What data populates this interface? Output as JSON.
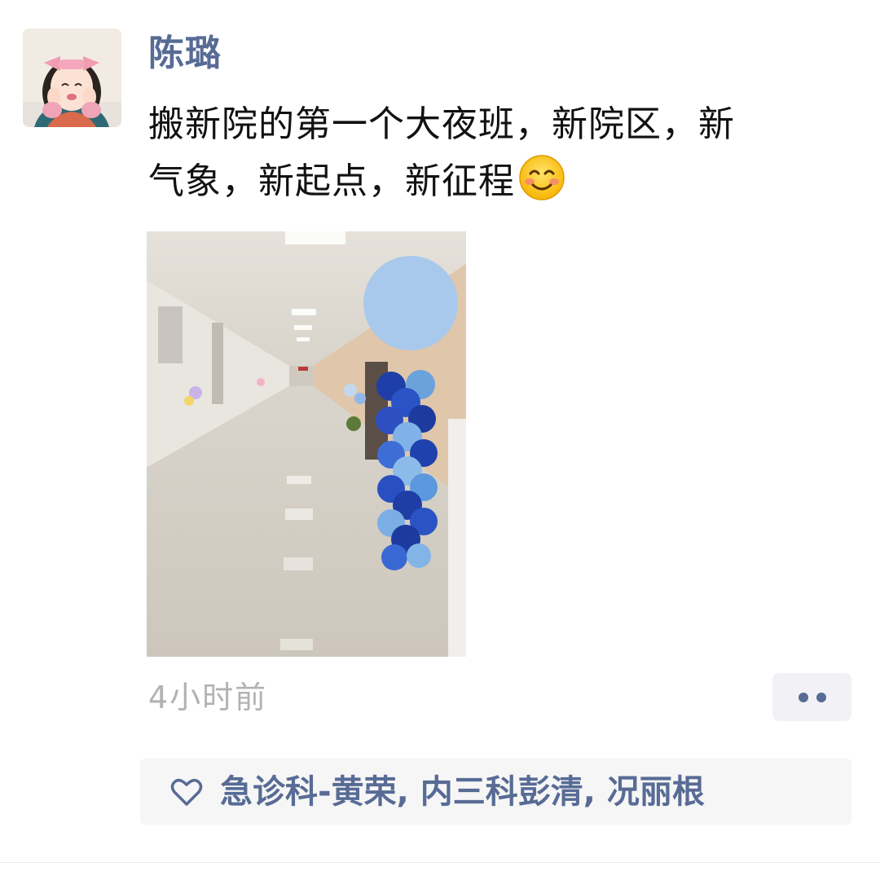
{
  "post": {
    "author": "陈璐",
    "content_line1": "搬新院的第一个大夜班，新院区，新",
    "content_line2": "气象，新起点，新征程",
    "time": "4小时前",
    "emoji": "smiling-face-icon",
    "photo": "hospital-corridor-balloon-photo"
  },
  "likes": {
    "icon": "heart-icon",
    "names": "急诊科-黄荣, 内三科彭清, 况丽根"
  },
  "colors": {
    "link": "#576b95",
    "time": "#b2b2b2",
    "likes_bg": "#f6f6f6"
  }
}
